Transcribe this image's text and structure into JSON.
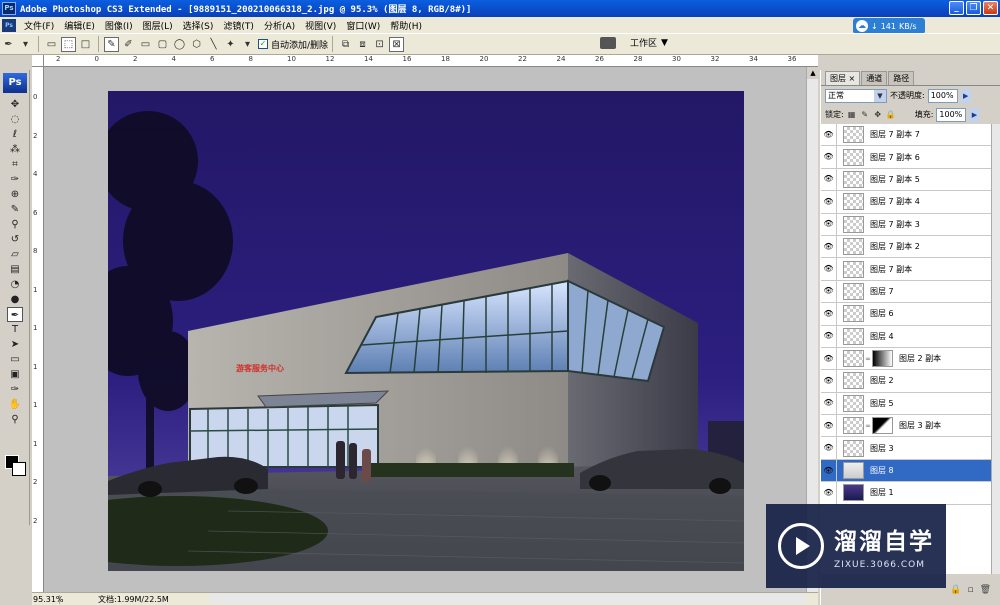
{
  "window": {
    "app_icon": "Ps",
    "title": "Adobe Photoshop CS3 Extended - [9889151_200210066318_2.jpg @ 95.3% (图层 8, RGB/8#)]",
    "buttons": [
      "minimize",
      "restore",
      "close"
    ]
  },
  "menu": {
    "items": [
      "文件(F)",
      "编辑(E)",
      "图像(I)",
      "图层(L)",
      "选择(S)",
      "滤镜(T)",
      "分析(A)",
      "视图(V)",
      "窗口(W)",
      "帮助(H)"
    ]
  },
  "net_speed": {
    "value": "141",
    "unit": "KB/s",
    "arrow": "↓"
  },
  "options_bar": {
    "auto_add_label": "自动添加/删除",
    "auto_add_checked": true,
    "workspace_label": "工作区"
  },
  "toolbox": {
    "logo": "Ps"
  },
  "rulers": {
    "top_ticks": [
      "2",
      "0",
      "2",
      "4",
      "6",
      "8",
      "10",
      "12",
      "14",
      "16",
      "18",
      "20",
      "22",
      "24",
      "26",
      "28",
      "30",
      "32",
      "34",
      "36"
    ],
    "left_ticks": [
      "0",
      "2",
      "4",
      "6",
      "8",
      "1",
      "1",
      "1",
      "1",
      "1",
      "2",
      "2"
    ]
  },
  "status": {
    "zoom": "95.31%",
    "doc_info": "文档:1.99M/22.5M"
  },
  "layers_panel": {
    "tabs": [
      "图层 ×",
      "通道",
      "路径"
    ],
    "blend_mode": "正常",
    "opacity_label": "不透明度:",
    "opacity_value": "100%",
    "lock_label": "锁定:",
    "fill_label": "填充:",
    "fill_value": "100%",
    "layers": [
      {
        "name": "图层 7 副本 7",
        "mask": false,
        "active": false
      },
      {
        "name": "图层 7 副本 6",
        "mask": false,
        "active": false
      },
      {
        "name": "图层 7 副本 5",
        "mask": false,
        "active": false
      },
      {
        "name": "图层 7 副本 4",
        "mask": false,
        "active": false
      },
      {
        "name": "图层 7 副本 3",
        "mask": false,
        "active": false
      },
      {
        "name": "图层 7 副本 2",
        "mask": false,
        "active": false
      },
      {
        "name": "图层 7 副本",
        "mask": false,
        "active": false
      },
      {
        "name": "图层 7",
        "mask": false,
        "active": false
      },
      {
        "name": "图层 6",
        "mask": false,
        "active": false
      },
      {
        "name": "图层 4",
        "mask": false,
        "active": false
      },
      {
        "name": "图层 2 副本",
        "mask": true,
        "active": false
      },
      {
        "name": "图层 2",
        "mask": false,
        "active": false
      },
      {
        "name": "图层 5",
        "mask": false,
        "active": false
      },
      {
        "name": "图层 3 副本",
        "mask": true,
        "active": false
      },
      {
        "name": "图层 3",
        "mask": false,
        "active": false
      },
      {
        "name": "图层 8",
        "mask": false,
        "active": true
      },
      {
        "name": "图层 1",
        "mask": false,
        "active": false
      }
    ]
  },
  "canvas": {
    "sign_text": "游客服务中心",
    "sky_color": "#271b73"
  },
  "watermark": {
    "name": "溜溜自学",
    "site": "ZIXUE.3066.COM"
  }
}
